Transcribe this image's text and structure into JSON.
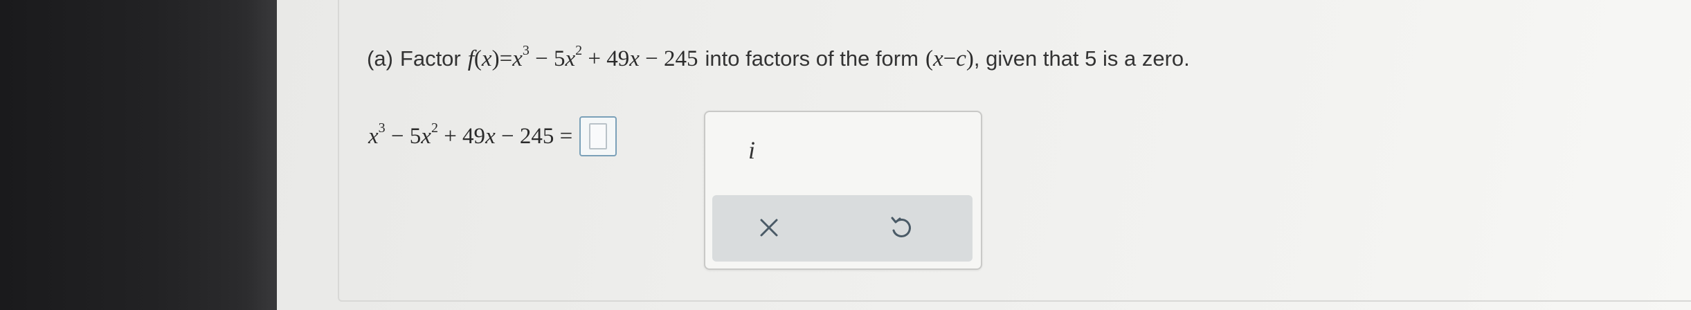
{
  "question": {
    "part_label": "(a)",
    "lead": "Factor",
    "function_name": "f",
    "function_var": "x",
    "polynomial": {
      "t1_base": "x",
      "t1_exp": "3",
      "t2": "− 5",
      "t2_base": "x",
      "t2_exp": "2",
      "t3": "+ 49",
      "t3_base": "x",
      "t4": "− 245"
    },
    "middle_text": "into factors of the form",
    "form_var": "x",
    "form_op": "−",
    "form_const": "c",
    "tail_text": ", given that 5 is a zero."
  },
  "equation": {
    "t1_base": "x",
    "t1_exp": "3",
    "t2": "− 5",
    "t2_base": "x",
    "t2_exp": "2",
    "t3": "+ 49",
    "t3_base": "x",
    "t4": "− 245",
    "equals": "=",
    "answer_value": ""
  },
  "tools": {
    "i_label": "i",
    "clear_icon": "x-icon",
    "undo_icon": "undo-icon"
  }
}
